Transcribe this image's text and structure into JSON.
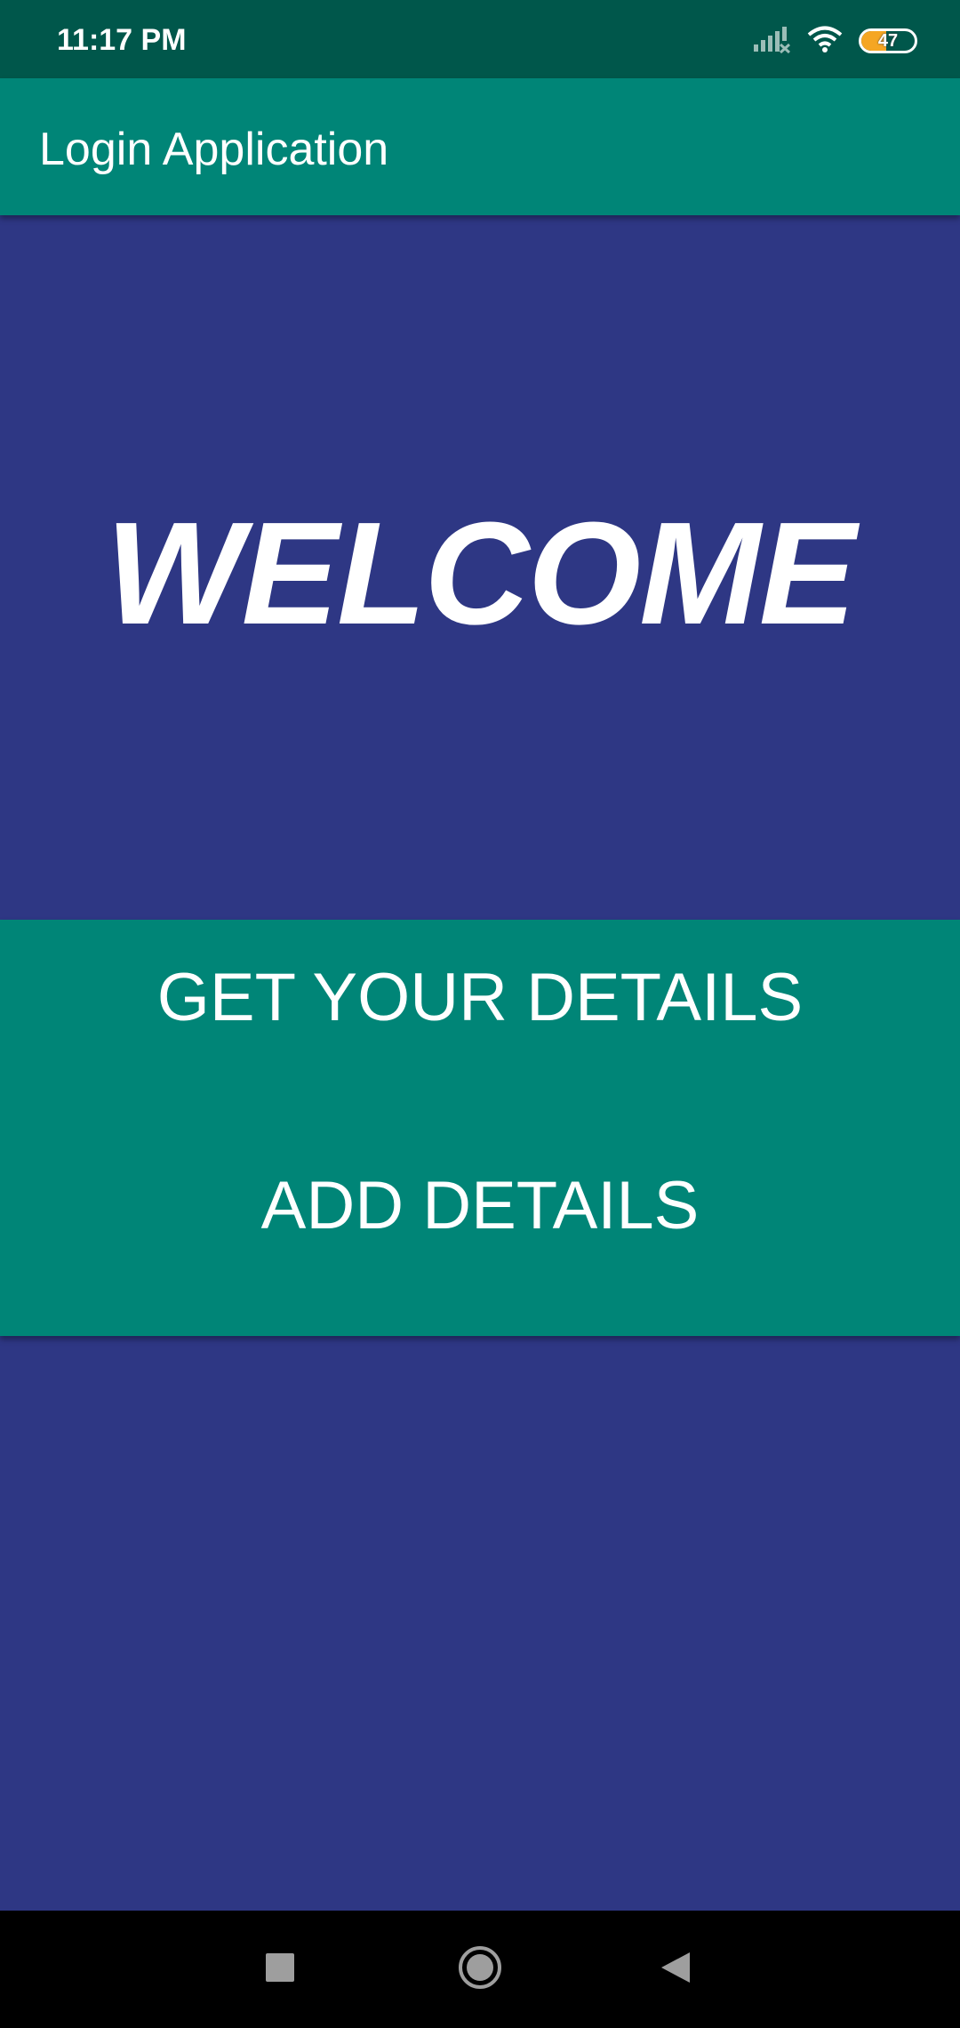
{
  "status_bar": {
    "time": "11:17 PM",
    "battery_level": "47",
    "battery_fraction": 0.47,
    "icons": [
      "signal-icon",
      "wifi-icon",
      "battery-icon"
    ]
  },
  "app_bar": {
    "title": "Login Application"
  },
  "main": {
    "welcome_text": "WELCOME"
  },
  "buttons": {
    "get_details_label": "GET YOUR DETAILS",
    "add_details_label": "ADD DETAILS"
  },
  "nav_bar": {
    "icons": [
      "recents-icon",
      "home-icon",
      "back-icon"
    ]
  },
  "colors": {
    "status_bar": "#00574b",
    "primary": "#008577",
    "background": "#2e3784",
    "text": "#ffffff",
    "battery_accent": "#f5a623"
  }
}
